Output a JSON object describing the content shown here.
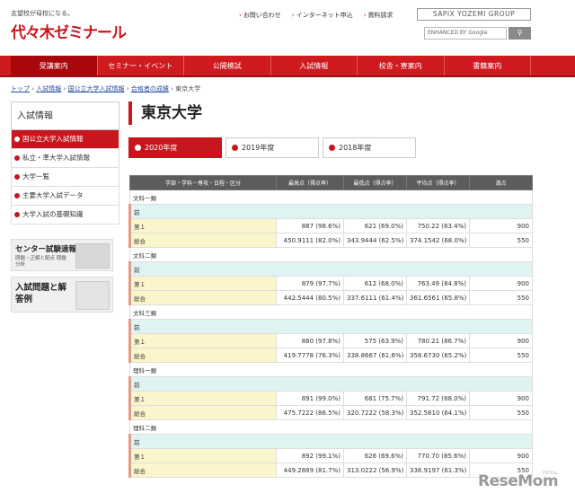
{
  "header": {
    "tagline": "志望校が母校になる。",
    "logo": "代々木ゼミナール",
    "links": [
      "お問い合わせ",
      "インターネット申込",
      "資料請求"
    ],
    "group": "SAPIX YOZEMI GROUP",
    "search_placeholder": "ENHANCED BY Google"
  },
  "nav": [
    "受講案内",
    "セミナー・イベント",
    "公開模試",
    "入試情報",
    "校舎・寮案内",
    "書籍案内"
  ],
  "breadcrumb": {
    "items": [
      "トップ",
      "入試情報",
      "国公立大学入試情報",
      "合格者の成績"
    ],
    "current": "東京大学",
    "sep": "›"
  },
  "sidebar": {
    "title": "入試情報",
    "items": [
      "国公立大学入試情報",
      "私立・準大学入試情報",
      "大学一覧",
      "主要大学入試データ",
      "大学入試の基礎知識"
    ],
    "banner1": {
      "title": "センター試験速報",
      "sub": "問題・正解と配点 問題分析"
    },
    "banner2": {
      "title": "入試問題と解答例"
    }
  },
  "page_title": "東京大学",
  "years": [
    "2020年度",
    "2019年度",
    "2018年度"
  ],
  "table": {
    "headers": [
      "学部・学科－専攻・日程・区分",
      "最高点（得点率）",
      "最低点（得点率）",
      "平均点（得点率）",
      "満点"
    ],
    "sections": [
      {
        "name": "文科一類",
        "pre": "前",
        "rows": [
          [
            "第１",
            "887 (98.6%)",
            "621 (69.0%)",
            "750.22 (83.4%)",
            "900"
          ],
          [
            "総合",
            "450.9111 (82.0%)",
            "343.9444 (62.5%)",
            "374.1542 (68.0%)",
            "550"
          ]
        ]
      },
      {
        "name": "文科二類",
        "pre": "前",
        "rows": [
          [
            "第１",
            "879 (97.7%)",
            "612 (68.0%)",
            "763.49 (84.8%)",
            "900"
          ],
          [
            "総合",
            "442.5444 (80.5%)",
            "337.6111 (61.4%)",
            "361.6561 (65.8%)",
            "550"
          ]
        ]
      },
      {
        "name": "文科三類",
        "pre": "前",
        "rows": [
          [
            "第１",
            "880 (97.8%)",
            "575 (63.9%)",
            "780.21 (86.7%)",
            "900"
          ],
          [
            "総合",
            "419.7778 (76.3%)",
            "338.8667 (61.6%)",
            "358.6730 (65.2%)",
            "550"
          ]
        ]
      },
      {
        "name": "理科一類",
        "pre": "前",
        "rows": [
          [
            "第１",
            "891 (99.0%)",
            "681 (75.7%)",
            "791.72 (88.0%)",
            "900"
          ],
          [
            "総合",
            "475.7222 (86.5%)",
            "320.7222 (58.3%)",
            "352.5810 (64.1%)",
            "550"
          ]
        ]
      },
      {
        "name": "理科二類",
        "pre": "前",
        "rows": [
          [
            "第１",
            "892 (99.1%)",
            "626 (69.6%)",
            "770.70 (85.6%)",
            "900"
          ],
          [
            "総合",
            "449.2889 (81.7%)",
            "313.0222 (56.9%)",
            "336.9197 (61.3%)",
            "550"
          ]
        ]
      }
    ]
  },
  "watermark": {
    "brand": "ReseMom",
    "kana": "リセマム"
  },
  "colors": {
    "brand_red": "#c7161d",
    "nav_red": "#cf1a1f"
  }
}
